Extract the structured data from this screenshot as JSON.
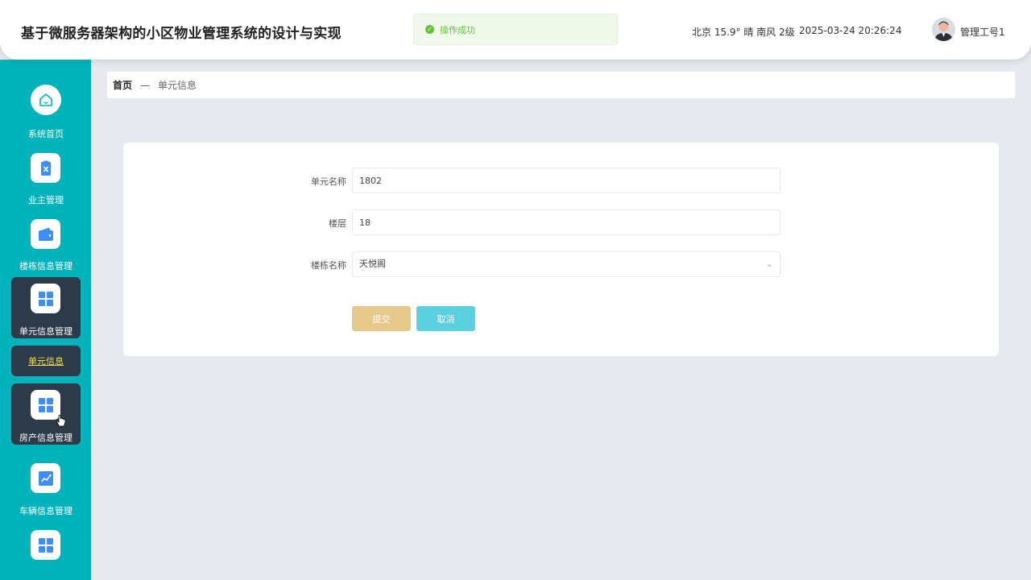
{
  "header": {
    "title": "基于微服务器架构的小区物业管理系统的设计与实现",
    "toast": "操作成功",
    "weather": "北京  15.9°  晴  南风  2级",
    "datetime": "2025-03-24 20:26:24",
    "username": "管理工号1"
  },
  "sidebar": {
    "items": [
      {
        "label": "系统首页",
        "icon": "home-icon"
      },
      {
        "label": "业主管理",
        "icon": "clipboard-icon"
      },
      {
        "label": "楼栋信息管理",
        "icon": "wallet-icon"
      },
      {
        "label": "单元信息管理",
        "icon": "grid-icon"
      },
      {
        "label": "房产信息管理",
        "icon": "grid-icon"
      },
      {
        "label": "车辆信息管理",
        "icon": "chart-icon"
      },
      {
        "label": "",
        "icon": "grid-icon"
      }
    ],
    "sub_item": "单元信息"
  },
  "breadcrumb": {
    "home": "首页",
    "sep": "—",
    "current": "单元信息"
  },
  "form": {
    "unit_name_label": "单元名称",
    "unit_name_value": "1802",
    "floor_label": "楼层",
    "floor_value": "18",
    "building_label": "楼栋名称",
    "building_value": "天悦阁",
    "submit": "提交",
    "cancel": "取消"
  },
  "colors": {
    "sidebar_bg": "#02b3bc",
    "active_bg": "#2d3a49",
    "icon_blue": "#3d8ff5",
    "submit_btn": "#e7c98c",
    "cancel_btn": "#5bd1e0",
    "toast_green": "#67c23a"
  }
}
